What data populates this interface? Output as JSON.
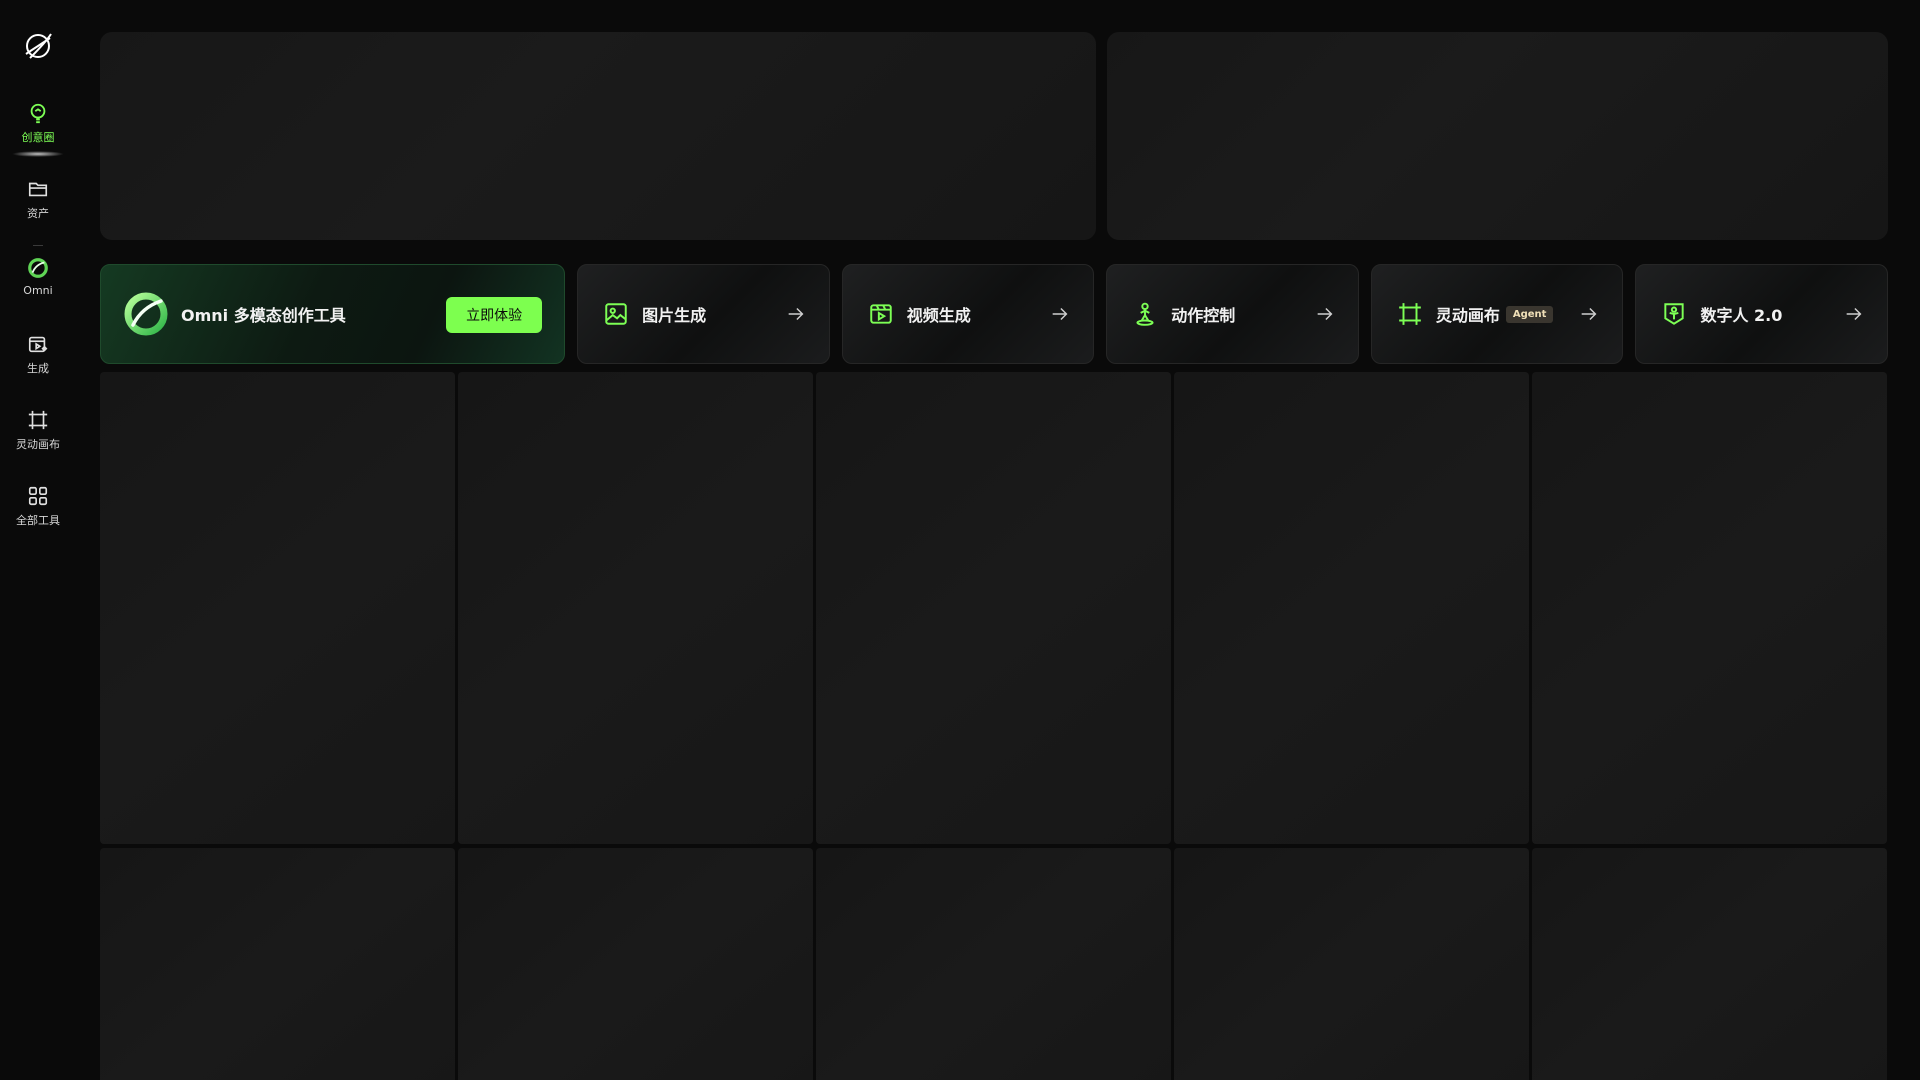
{
  "sidebar": {
    "logo_icon": "app-logo-icon",
    "items": [
      {
        "label": "创意圈",
        "icon": "bulb-icon",
        "active": true
      },
      {
        "label": "资产",
        "icon": "folder-icon",
        "active": false
      },
      {
        "label": "Omni",
        "icon": "omni-ring-icon",
        "active": false
      },
      {
        "label": "生成",
        "icon": "generate-icon",
        "active": false
      },
      {
        "label": "灵动画布",
        "icon": "canvas-frame-icon",
        "active": false
      },
      {
        "label": "全部工具",
        "icon": "grid-icon",
        "active": false
      }
    ]
  },
  "tools": {
    "omni": {
      "label": "Omni 多模态创作工具",
      "button": "立即体验"
    },
    "items": [
      {
        "label": "图片生成",
        "icon": "image-icon"
      },
      {
        "label": "视频生成",
        "icon": "video-icon"
      },
      {
        "label": "动作控制",
        "icon": "motion-icon"
      },
      {
        "label": "灵动画布",
        "icon": "canvas-frame-icon",
        "badge": "Agent"
      },
      {
        "label": "数字人 2.0",
        "icon": "digital-human-icon"
      }
    ]
  },
  "colors": {
    "accent": "#7dff4f",
    "background": "#0a0a0a",
    "card": "#171717"
  }
}
